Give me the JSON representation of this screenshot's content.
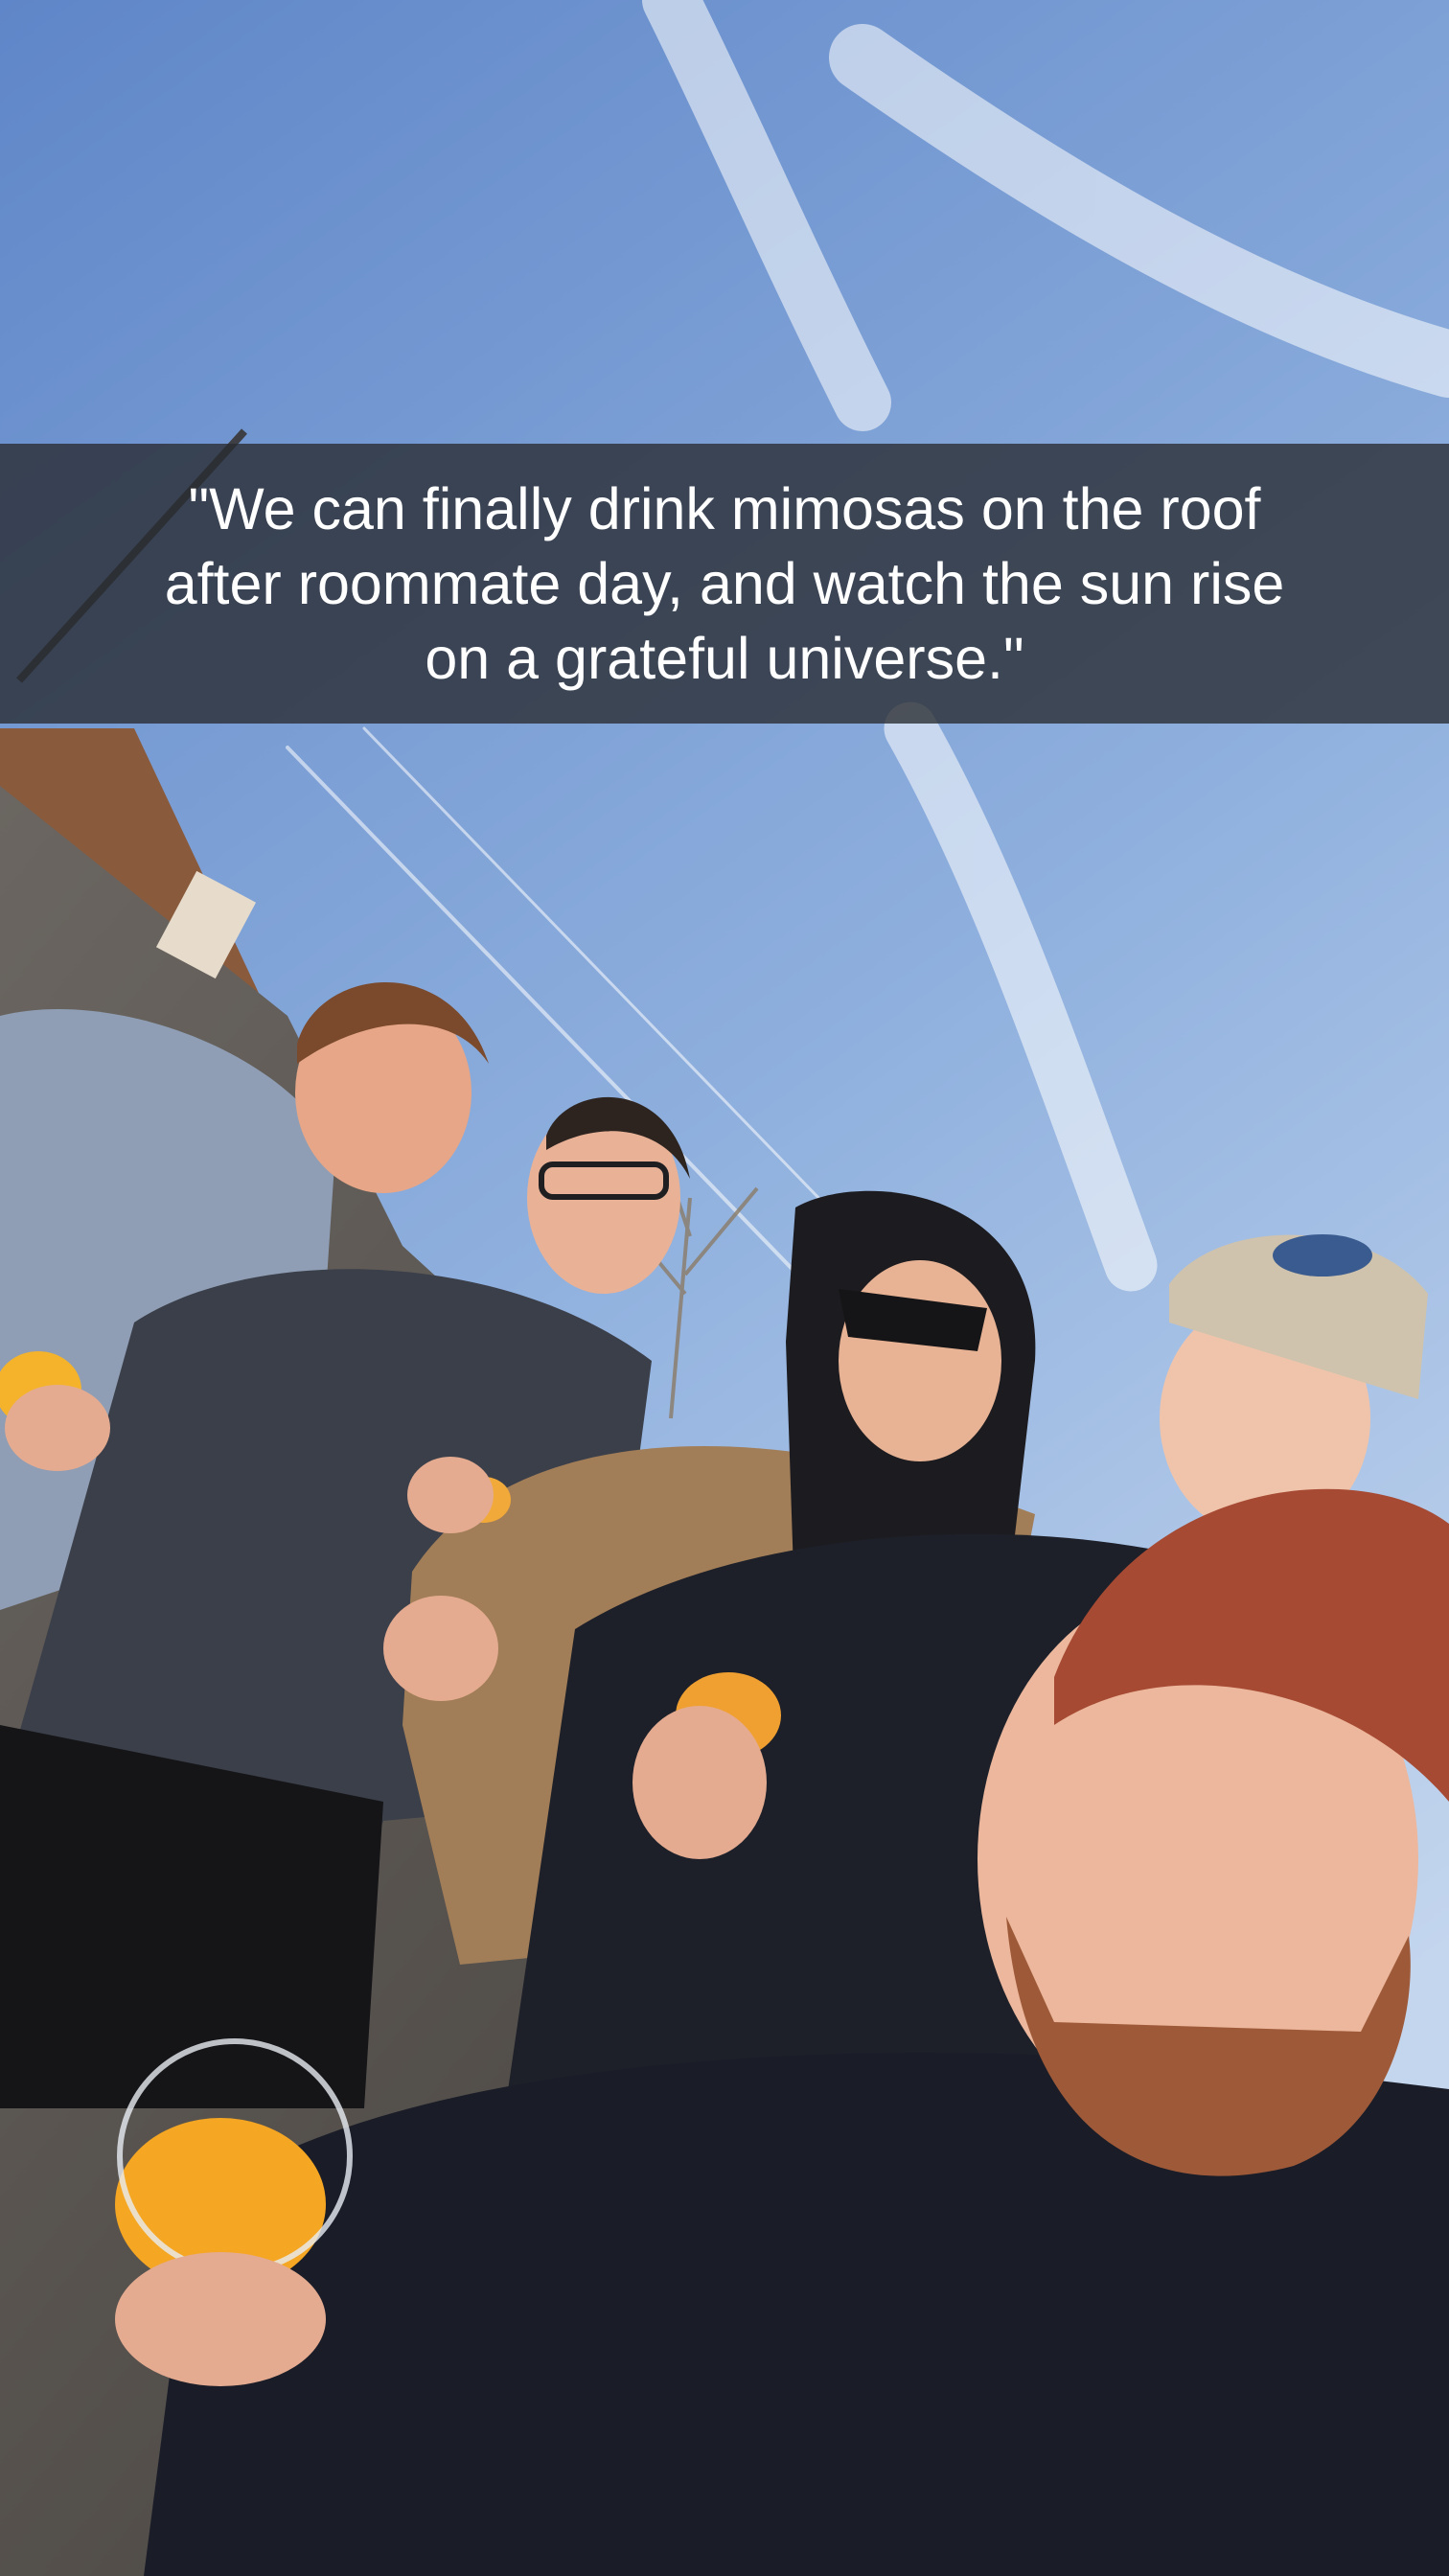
{
  "caption": {
    "text": "\"We can finally drink mimosas on the roof\nafter roommate day, and watch the sun rise\non a grateful universe.\""
  },
  "photo": {
    "sky_top_color": "#6b8fcc",
    "sky_bottom_color": "#b9cdea",
    "roof_color": "#5a5550",
    "brick_color": "#8a5a3c",
    "mimosa_color": "#f5a623",
    "beanie_color": "#a64a33"
  }
}
